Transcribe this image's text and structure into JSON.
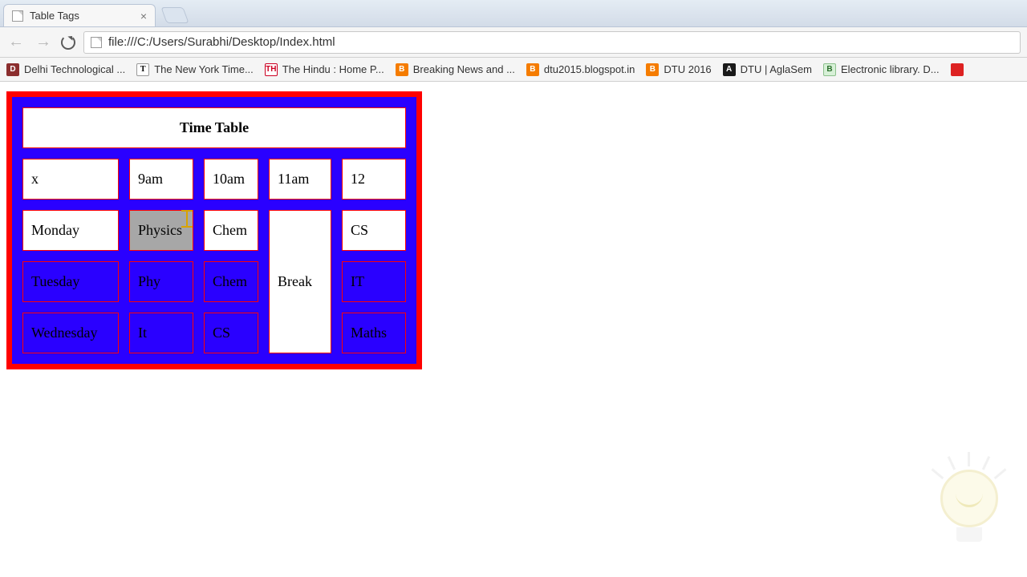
{
  "browser": {
    "tab_title": "Table Tags",
    "url": "file:///C:/Users/Surabhi/Desktop/Index.html"
  },
  "bookmarks": [
    "Delhi Technological ...",
    "The New York Time...",
    "The Hindu : Home P...",
    "Breaking News and ...",
    "dtu2015.blogspot.in",
    "DTU 2016",
    "DTU | AglaSem",
    "Electronic library. D..."
  ],
  "table": {
    "title": "Time Table",
    "headers": [
      "x",
      "9am",
      "10am",
      "11am",
      "12"
    ],
    "break_label": "Break",
    "rows": [
      {
        "day": "Monday",
        "c9": "Physics",
        "c10": "Chem",
        "c12": "CS",
        "style": "white",
        "sel9": true
      },
      {
        "day": "Tuesday",
        "c9": "Phy",
        "c10": "Chem",
        "c12": "IT",
        "style": "blue"
      },
      {
        "day": "Wednesday",
        "c9": "It",
        "c10": "CS",
        "c12": "Maths",
        "style": "blue"
      }
    ]
  }
}
